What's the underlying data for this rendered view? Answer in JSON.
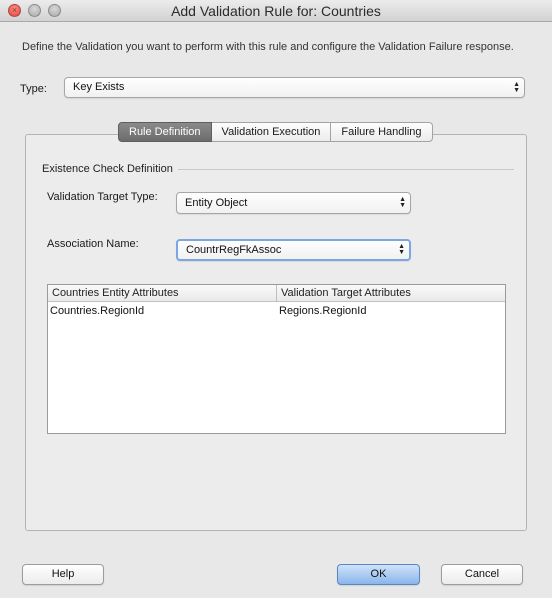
{
  "window": {
    "title": "Add Validation Rule for: Countries"
  },
  "description": "Define the Validation you want to perform with this rule and configure the Validation Failure response.",
  "type": {
    "label": "Type:",
    "value": "Key Exists"
  },
  "tabs": [
    {
      "label": "Rule Definition",
      "active": true
    },
    {
      "label": "Validation Execution",
      "active": false
    },
    {
      "label": "Failure Handling",
      "active": false
    }
  ],
  "definition": {
    "section_title": "Existence Check Definition",
    "validation_target_type": {
      "label": "Validation Target Type:",
      "value": "Entity Object"
    },
    "association_name": {
      "label": "Association Name:",
      "value": "CountrRegFkAssoc"
    },
    "table": {
      "columns": [
        "Countries Entity Attributes",
        "Validation Target Attributes"
      ],
      "rows": [
        [
          "Countries.RegionId",
          "Regions.RegionId"
        ]
      ]
    }
  },
  "buttons": {
    "help": "Help",
    "ok": "OK",
    "cancel": "Cancel"
  },
  "colors": {
    "accent": "#8ab5ea",
    "focus_ring": "#7aa7e3",
    "close": "#e0443a"
  }
}
